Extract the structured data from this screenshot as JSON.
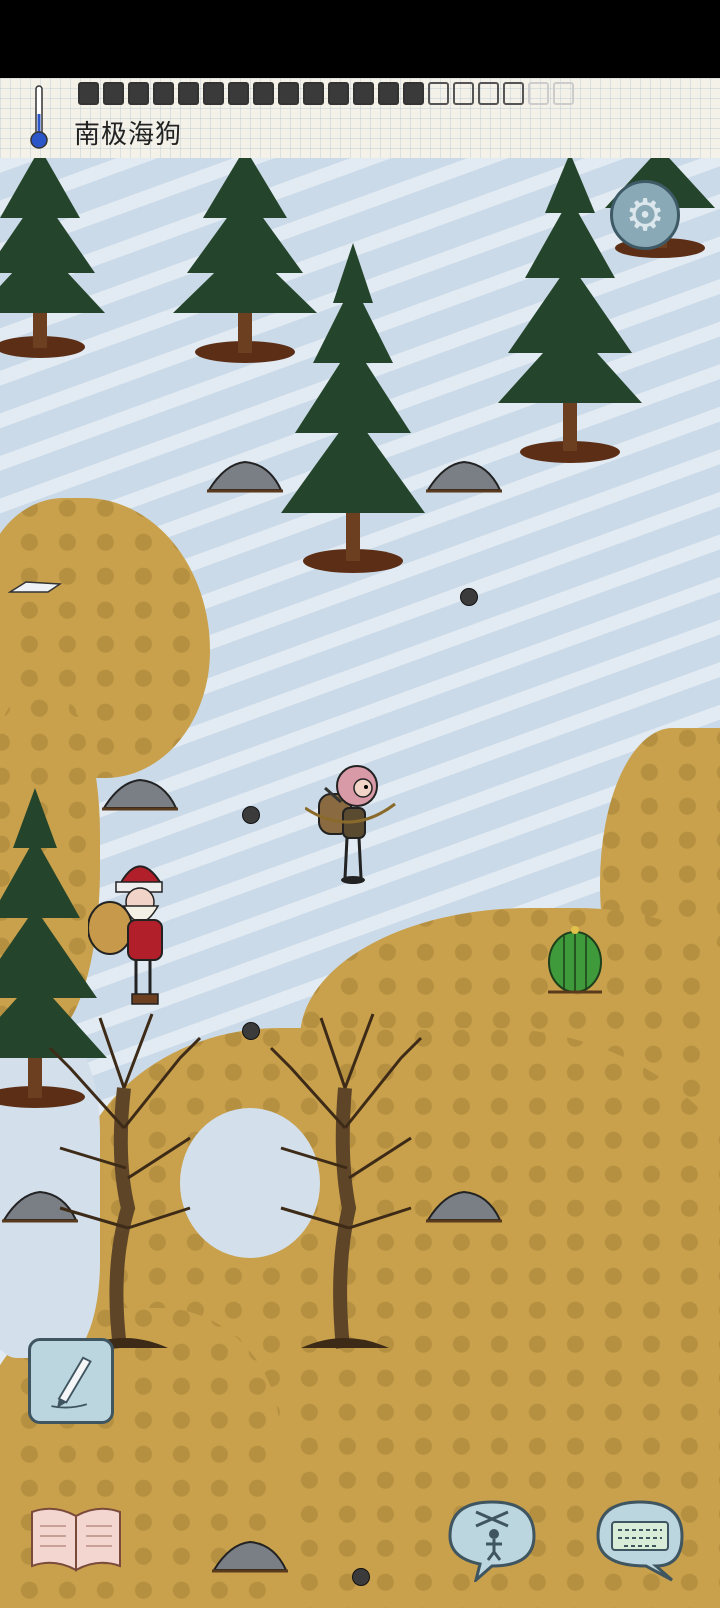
{
  "header": {
    "biome_name": "南极海狗",
    "food_meter": {
      "filled": 14,
      "empty": 4,
      "faint": 2
    }
  },
  "icons": {
    "thermometer": "thermometer-icon",
    "settings": "gear-icon",
    "write": "pencil-icon",
    "journal": "book-icon",
    "emote": "puppet-icon",
    "chat": "keyboard-icon"
  },
  "colors": {
    "snow": "#d3e0ec",
    "dirt": "#c9a14c",
    "tree": "#24452b",
    "button_bg": "#bcd6e0"
  }
}
